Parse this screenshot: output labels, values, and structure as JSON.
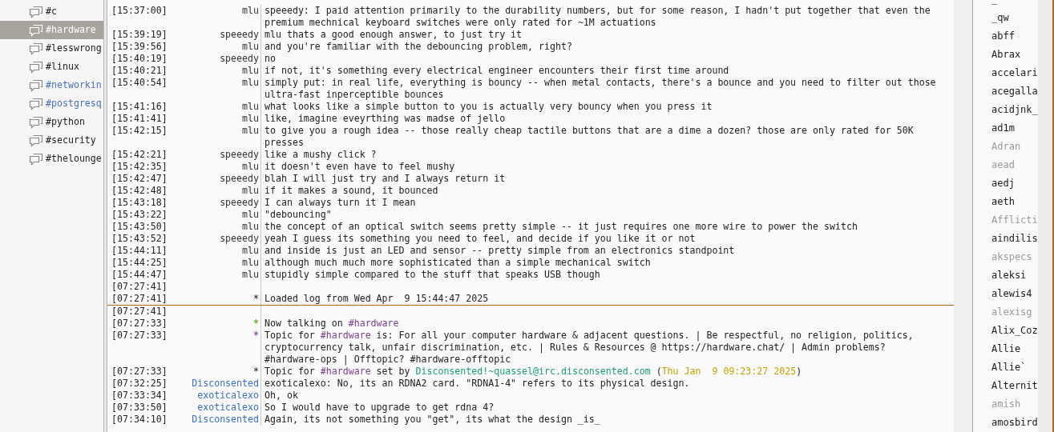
{
  "channels": [
    {
      "name": "#c",
      "selected": false,
      "activity": false
    },
    {
      "name": "#hardware",
      "selected": true,
      "activity": false
    },
    {
      "name": "#lesswrong",
      "selected": false,
      "activity": false
    },
    {
      "name": "#linux",
      "selected": false,
      "activity": false
    },
    {
      "name": "#networkin",
      "selected": false,
      "activity": true
    },
    {
      "name": "#postgresq",
      "selected": false,
      "activity": true
    },
    {
      "name": "#python",
      "selected": false,
      "activity": false
    },
    {
      "name": "#security",
      "selected": false,
      "activity": false
    },
    {
      "name": "#thelounge",
      "selected": false,
      "activity": false
    }
  ],
  "messages": [
    {
      "time": "[15:37:00]",
      "nick": "mlu",
      "color": "#333333",
      "text": "speeedy: I paid attention primarily to the durability numbers, but for some reason, I hadn't put together that even the premium mechnical keyboard switches were only rated for ~1M actuations"
    },
    {
      "time": "[15:39:19]",
      "nick": "speeedy",
      "color": "#333333",
      "text": "mlu thats a good enough answer, to just try it"
    },
    {
      "time": "[15:39:56]",
      "nick": "mlu",
      "color": "#333333",
      "text": "and you're familiar with the debouncing problem, right?"
    },
    {
      "time": "[15:40:19]",
      "nick": "speeedy",
      "color": "#333333",
      "text": "no"
    },
    {
      "time": "[15:40:21]",
      "nick": "mlu",
      "color": "#333333",
      "text": "if not, it's something every electrical engineer encounters their first time around"
    },
    {
      "time": "[15:40:54]",
      "nick": "mlu",
      "color": "#333333",
      "text": "simply put: in real life, everything is bouncy -- when metal contacts, there's a bounce and you need to filter out those ultra-fast inperceptible bounces"
    },
    {
      "time": "[15:41:16]",
      "nick": "mlu",
      "color": "#333333",
      "text": "what looks like a simple button to you is actually very bouncy when you press it"
    },
    {
      "time": "[15:41:41]",
      "nick": "mlu",
      "color": "#333333",
      "text": "like, imagine eveyrthing was madse of jello"
    },
    {
      "time": "[15:42:15]",
      "nick": "mlu",
      "color": "#333333",
      "text": "to give you a rough idea -- those really cheap tactile buttons that are a dime a dozen? those are only rated for 50K presses"
    },
    {
      "time": "[15:42:21]",
      "nick": "speeedy",
      "color": "#333333",
      "text": "like a mushy click ?"
    },
    {
      "time": "[15:42:35]",
      "nick": "mlu",
      "color": "#333333",
      "text": "it doesn't even have to feel mushy"
    },
    {
      "time": "[15:42:47]",
      "nick": "speeedy",
      "color": "#333333",
      "text": "blah I will just try and I always return it"
    },
    {
      "time": "[15:42:48]",
      "nick": "mlu",
      "color": "#333333",
      "text": "if it makes a sound, it bounced"
    },
    {
      "time": "[15:43:18]",
      "nick": "speeedy",
      "color": "#333333",
      "text": "I can always turn it I mean"
    },
    {
      "time": "[15:43:22]",
      "nick": "mlu",
      "color": "#333333",
      "text": "\"debouncing\""
    },
    {
      "time": "[15:43:50]",
      "nick": "mlu",
      "color": "#333333",
      "text": "the concept of an optical switch seems pretty simple -- it just requires one more wire to power the switch"
    },
    {
      "time": "[15:43:52]",
      "nick": "speeedy",
      "color": "#333333",
      "text": "yeah I guess its something you need to feel, and decide if you like it or not"
    },
    {
      "time": "[15:44:11]",
      "nick": "mlu",
      "color": "#333333",
      "text": "and inside is just an LED and sensor -- pretty simple from an electronics standpoint"
    },
    {
      "time": "[15:44:25]",
      "nick": "mlu",
      "color": "#333333",
      "text": "although much much more sophisticated than a simple mechanical switch"
    },
    {
      "time": "[15:44:47]",
      "nick": "mlu",
      "color": "#333333",
      "text": "stupidly simple compared to the stuff that speaks USB though"
    },
    {
      "time": "[07:27:41]"
    },
    {
      "time": "[07:27:41]",
      "nick": "*",
      "text": "Loaded log from Wed Apr  9 15:44:47 2025",
      "marker_below": true
    },
    {
      "time": "[07:27:41]"
    },
    {
      "time": "[07:27:33]",
      "nick": "*",
      "color": "#6aaa3a",
      "parts": [
        {
          "text": "Now talking on "
        },
        {
          "text": "#hardware",
          "color": "#7b3f8f"
        }
      ]
    },
    {
      "time": "[07:27:33]",
      "nick": "*",
      "color": "#9a4fa8",
      "parts": [
        {
          "text": "Topic for "
        },
        {
          "text": "#hardware",
          "color": "#7b3f8f"
        },
        {
          "text": " is: For all your computer hardware & adjacent questions. | Be respectful, no religion, politics, cryptocurrency talk, unfair discrimination, etc. | Rules & Resources @ https://hardware.chat/ | Admin problems? #hardware-ops | Offtopic? #hardware-offtopic"
        }
      ]
    },
    {
      "time": "[07:27:33]",
      "nick": "*",
      "parts": [
        {
          "text": "Topic for "
        },
        {
          "text": "#hardware",
          "color": "#7b3f8f"
        },
        {
          "text": " set by "
        },
        {
          "text": "Disconsented!~quassel@irc.disconsented.com",
          "color": "#1a9e78"
        },
        {
          "text": " ("
        },
        {
          "text": "Thu Jan  9 09:23:27 2025",
          "color": "#c9a200"
        },
        {
          "text": ")"
        }
      ]
    },
    {
      "time": "[07:32:25]",
      "nick": "Disconsented",
      "color": "#3b6fc0",
      "text": "exoticalexo: No, its an RDNA2 card. \"RDNA1-4\" refers to its physical design."
    },
    {
      "time": "[07:33:34]",
      "nick": "exoticalexo",
      "color": "#3b6fc0",
      "text": "Oh, ok"
    },
    {
      "time": "[07:33:50]",
      "nick": "exoticalexo",
      "color": "#3b6fc0",
      "text": "So I would have to upgrade to get rdna 4?"
    },
    {
      "time": "[07:34:10]",
      "nick": "Disconsented",
      "color": "#3b6fc0",
      "text": "Again, its not something you \"get\", its what the design _is_"
    }
  ],
  "nicks": [
    {
      "name": "_",
      "away": false
    },
    {
      "name": "_qw",
      "away": false
    },
    {
      "name": "abff",
      "away": false
    },
    {
      "name": "Abrax",
      "away": false
    },
    {
      "name": "accelari",
      "away": false
    },
    {
      "name": "acegalla",
      "away": false
    },
    {
      "name": "acidjnk_",
      "away": false
    },
    {
      "name": "ad1m",
      "away": false
    },
    {
      "name": "Adran",
      "away": true
    },
    {
      "name": "aead",
      "away": true
    },
    {
      "name": "aedj",
      "away": false
    },
    {
      "name": "aeth",
      "away": false
    },
    {
      "name": "Afflicti",
      "away": true
    },
    {
      "name": "aindilis",
      "away": false
    },
    {
      "name": "akspecs",
      "away": true
    },
    {
      "name": "aleksi",
      "away": false
    },
    {
      "name": "alewis4",
      "away": false
    },
    {
      "name": "alexisg",
      "away": true
    },
    {
      "name": "Alix_Coz",
      "away": false
    },
    {
      "name": "Allie",
      "away": false
    },
    {
      "name": "Allie`",
      "away": false
    },
    {
      "name": "Alternit",
      "away": false
    },
    {
      "name": "amish",
      "away": true
    },
    {
      "name": "amosbird",
      "away": false
    }
  ]
}
